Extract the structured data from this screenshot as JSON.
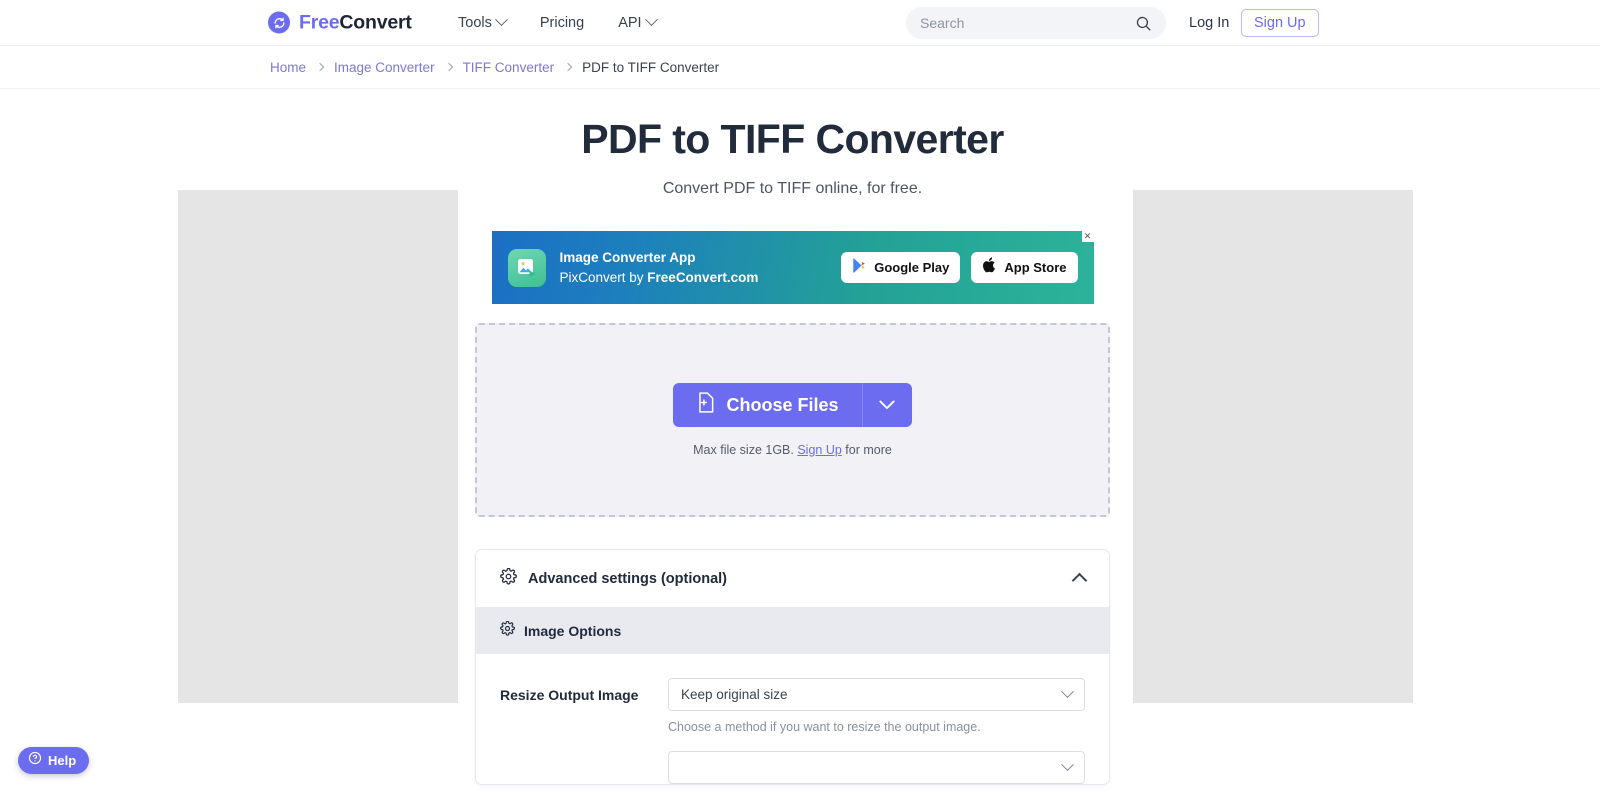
{
  "header": {
    "logo": {
      "icon": "refresh-circle-icon",
      "part1": "Free",
      "part2": "Convert"
    },
    "nav": [
      {
        "label": "Tools",
        "has_caret": true
      },
      {
        "label": "Pricing",
        "has_caret": false
      },
      {
        "label": "API",
        "has_caret": true
      }
    ],
    "search": {
      "placeholder": "Search",
      "value": "",
      "icon": "search-icon"
    },
    "login_label": "Log In",
    "signup_label": "Sign Up"
  },
  "breadcrumb": {
    "items": [
      {
        "label": "Home",
        "current": false
      },
      {
        "label": "Image Converter",
        "current": false
      },
      {
        "label": "TIFF Converter",
        "current": false
      },
      {
        "label": "PDF to TIFF Converter",
        "current": true
      }
    ]
  },
  "hero": {
    "title": "PDF to TIFF Converter",
    "subtitle": "Convert PDF to TIFF online, for free."
  },
  "ad": {
    "app_icon": "image-app-icon",
    "line1": "Image Converter App",
    "line2_prefix": "PixConvert by ",
    "line2_brand": "FreeConvert.com",
    "google_play_label": "Google Play",
    "app_store_label": "App Store",
    "close_label": "✕"
  },
  "dropzone": {
    "choose_label": "Choose Files",
    "choose_icon": "file-plus-icon",
    "dropdown_icon": "chevron-down-icon",
    "max_size_prefix": "Max file size 1GB. ",
    "max_size_link": "Sign Up",
    "max_size_suffix": " for more"
  },
  "advanced": {
    "header_label": "Advanced settings (optional)",
    "header_icon": "gear-icon",
    "collapse_icon": "chevron-up-icon",
    "image_options_label": "Image Options",
    "image_options_icon": "gear-icon",
    "fields": [
      {
        "label": "Resize Output Image",
        "value": "Keep original size",
        "help": "Choose a method if you want to resize the output image."
      }
    ]
  },
  "help_widget": {
    "label": "Help",
    "icon": "question-circle-icon"
  },
  "colors": {
    "brand_purple": "#6c6cf0",
    "heading_navy": "#222b3c",
    "breadcrumb_link": "#7a7ad1",
    "options_header_bg": "#e8eaf0",
    "dropzone_bg": "#f1f1f6"
  }
}
